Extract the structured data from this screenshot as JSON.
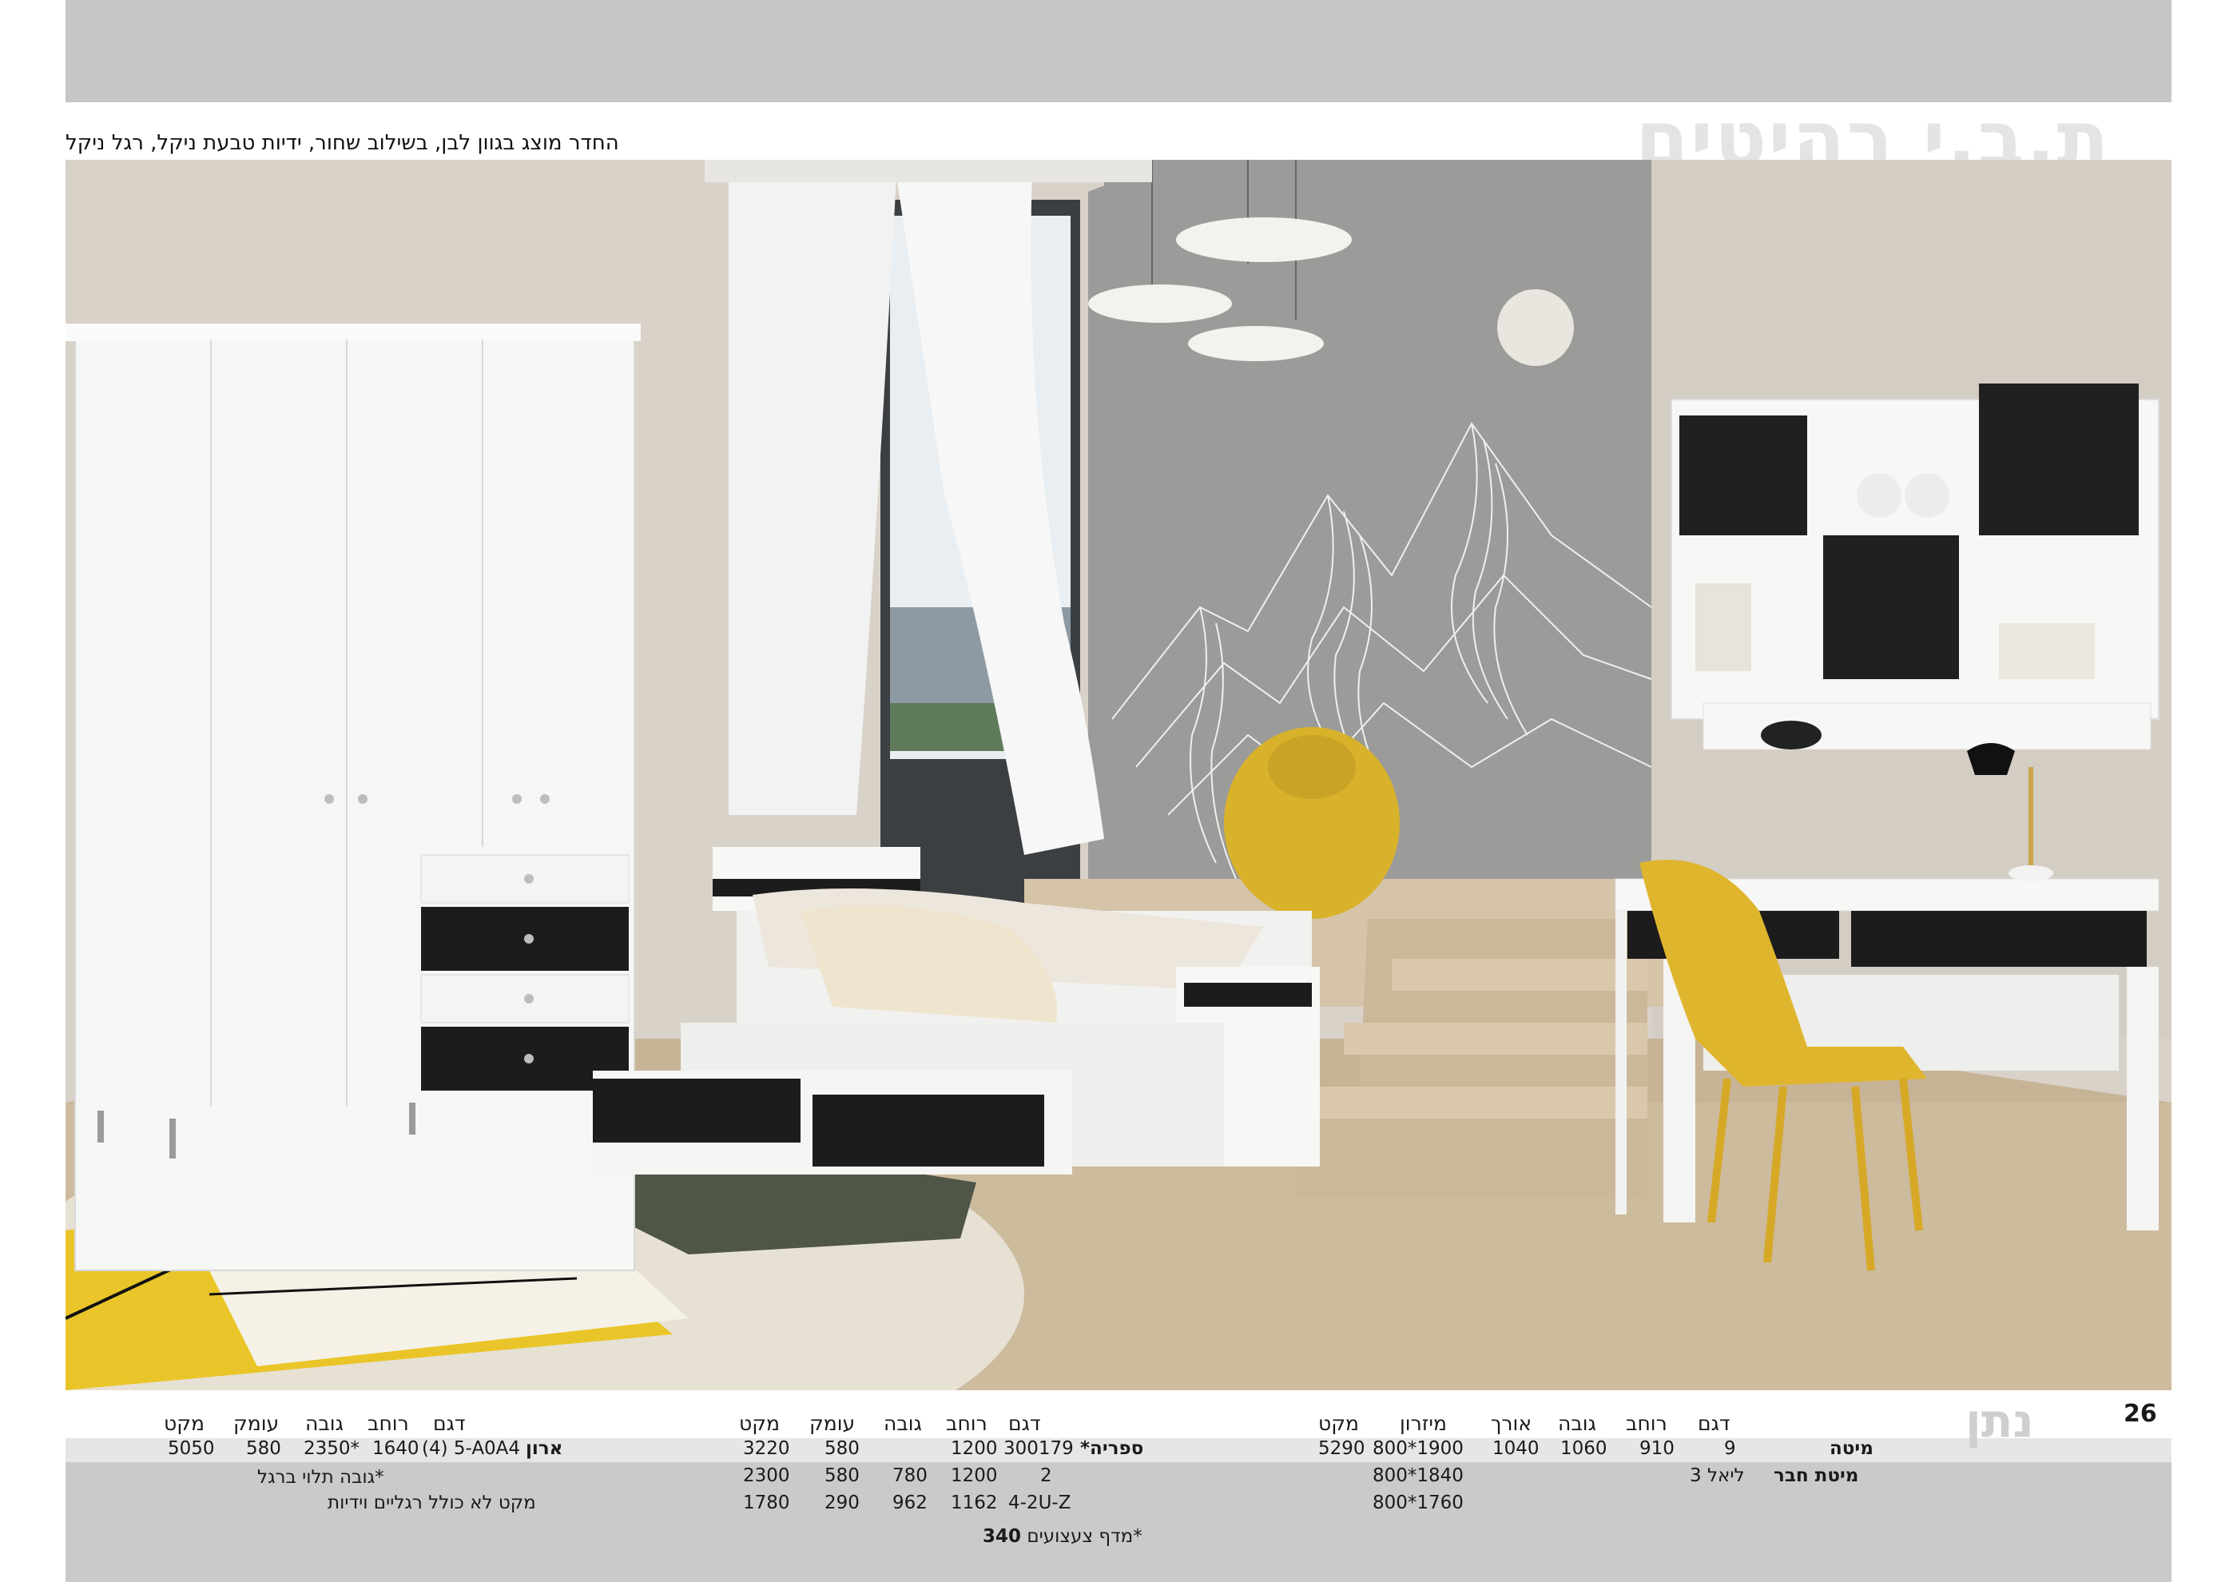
{
  "brand": "ת.ב.י רהיטים",
  "caption": "החדר מוצג בגוון לבן, בשילוב שחור, ידיות טבעת ניקל, רגל ניקל",
  "page_number": "26",
  "collection_name": "נתן",
  "bed_table": {
    "headers": {
      "model": "דגם",
      "width": "רוחב",
      "height": "גובה",
      "length": "אורך",
      "mattress": "מיזרון",
      "sku": "מקט"
    },
    "rows": [
      {
        "name": "מיטה",
        "model": "9",
        "width": "910",
        "height": "1060",
        "length": "1040",
        "mattress": "800*1900",
        "sku": "5290"
      },
      {
        "name": "מיטת חבר",
        "model": "ליאל 3",
        "mattress": "800*1840"
      },
      {
        "mattress": "800*1760"
      }
    ]
  },
  "shelf_table": {
    "headers": {
      "model": "דגם",
      "width": "רוחב",
      "height": "גובה",
      "depth": "עומק",
      "sku": "מקט"
    },
    "rows": [
      {
        "name": "ספריה*",
        "model": "300179",
        "width": "1200",
        "height": "",
        "depth": "580",
        "sku": "3220"
      },
      {
        "model": "2",
        "width": "1200",
        "height": "780",
        "depth": "580",
        "sku": "2300"
      },
      {
        "model": "4-2U-Z",
        "width": "1162",
        "height": "962",
        "depth": "290",
        "sku": "1780"
      }
    ],
    "note_bold": "340",
    "note": "*מדף צעצועים"
  },
  "wardrobe_table": {
    "headers": {
      "model": "דגם",
      "width": "רוחב",
      "height": "גובה",
      "depth": "עומק",
      "sku": "מקט"
    },
    "rows": [
      {
        "name": "ארון",
        "model": "(4) 5-A0A4",
        "width": "1640",
        "height": "2350*",
        "depth": "580",
        "sku": "5050"
      }
    ],
    "note1": "*גובה תלוי ברגל",
    "note2": "מקט לא כולל רגליים וידיות"
  },
  "colors": {
    "accent_yellow": "#e8c22a",
    "black_fronts": "#1c1c1c",
    "white_furniture": "#f7f7f5",
    "wall": "#d9d4cc",
    "feature_wall": "#9a9a98",
    "floor": "#c9b69a"
  }
}
